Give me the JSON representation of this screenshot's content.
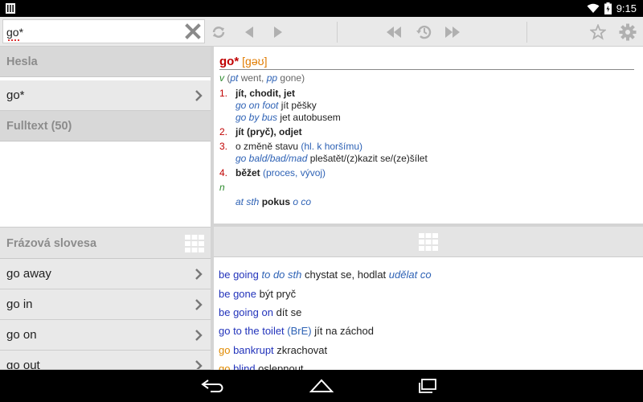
{
  "status_bar": {
    "time": "9:15",
    "battery_level": ""
  },
  "toolbar": {
    "search_value": "go*",
    "icons": [
      "clear-icon",
      "swap-icon",
      "back-arrow-icon",
      "forward-arrow-icon",
      "history-back-icon",
      "history-icon",
      "history-forward-icon",
      "star-icon",
      "settings-icon"
    ]
  },
  "left_panel": {
    "headwords_header": "Hesla",
    "headword_item": "go*",
    "fulltext_header": "Fulltext (50)",
    "phrasal_header": "Frázová slovesa",
    "phrasal_items": [
      "go away",
      "go in",
      "go on",
      "go out"
    ]
  },
  "entry": {
    "headword": "go*",
    "pronunciation": "[gəʊ]",
    "pos_v": "v",
    "forms": {
      "open": "(",
      "pt_label": "pt",
      "pt": " went, ",
      "pp_label": "pp",
      "pp": " gone",
      "close": ")"
    },
    "senses": [
      {
        "num": "1.",
        "text": "jít, chodit, jet"
      },
      {
        "num": "2.",
        "text": "jít (pryč), odjet"
      },
      {
        "num": "3.",
        "text": "o změně stavu ",
        "note": "(hl. k horšímu)"
      },
      {
        "num": "4.",
        "text": "běžet ",
        "note": "(proces, vývoj)"
      }
    ],
    "examples": [
      {
        "en": "go on foot",
        "cz": " jít pěšky"
      },
      {
        "en": "go by bus",
        "cz": " jet autobusem"
      },
      {
        "en": "go bald/bad/mad",
        "cz": " plešatět/(z)kazit se/(ze)šílet"
      }
    ],
    "pos_n": "n",
    "noun_example": {
      "en": "at sth ",
      "cz": "pokus",
      "tail": " o co"
    }
  },
  "phrases": [
    {
      "en": "be going",
      "extra": " to do sth",
      "cz": "  chystat se, hodlat ",
      "cz_extra": "udělat co"
    },
    {
      "en": "be gone",
      "cz": "  být pryč"
    },
    {
      "en": "be going on",
      "cz": "  dít se"
    },
    {
      "en": "go to the toilet",
      "extra": "  (BrE)",
      "cz": " jít na záchod"
    },
    {
      "go": "go",
      "en": " bankrupt",
      "cz": "  zkrachovat"
    },
    {
      "go": "go",
      "en": " blind",
      "cz": "  oslepnout"
    }
  ]
}
